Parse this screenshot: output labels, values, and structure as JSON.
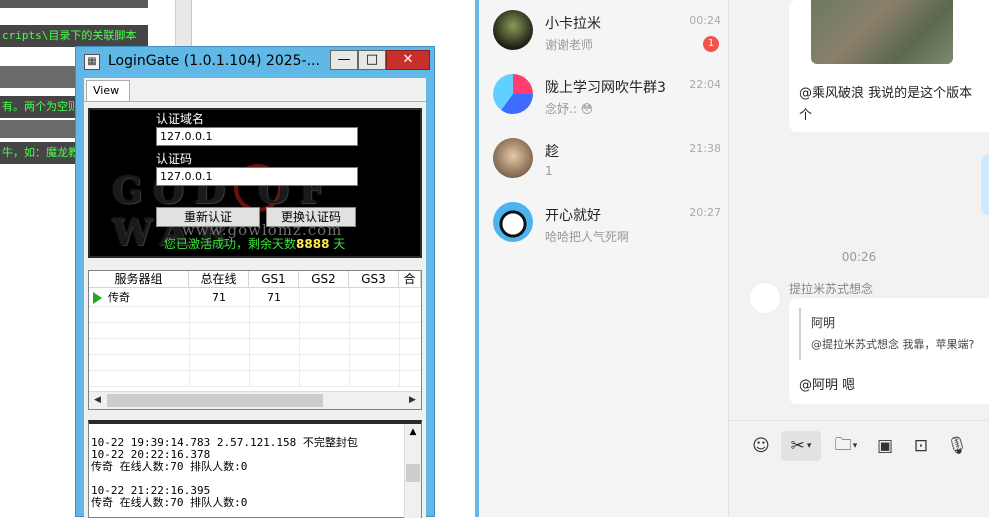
{
  "editor_bg": {
    "lines": [
      {
        "text": "cripts\\目录下的关联脚本"
      },
      {
        "text": "有。两个为空则"
      },
      {
        "text": "牛，如：魔龙教"
      }
    ]
  },
  "login_gate": {
    "title": "LoginGate (1.0.1.104)  2025-...",
    "minimize": "—",
    "maximize": "□",
    "close": "✕",
    "tab_view": "View",
    "auth_domain_label": "认证域名",
    "auth_domain_value": "127.0.0.1",
    "auth_code_label": "认证码",
    "auth_code_value": "127.0.0.1",
    "btn_reauth": "重新认证",
    "btn_change_code": "更换认证码",
    "status_prefix": "您已激活成功，剩余天数",
    "status_days": "8888",
    "status_suffix": "天",
    "banner_url": "www.gowlomz.com",
    "banner_logo": "GOD OF WAR",
    "columns": [
      "服务器组",
      "总在线",
      "GS1",
      "GS2",
      "GS3",
      "合计"
    ],
    "rows": [
      {
        "name": "传奇",
        "total": "71",
        "gs1": "71"
      }
    ],
    "log": [
      "10-22 19:39:14.783 2.57.121.158 不完整封包",
      "10-22 20:22:16.378",
      "传奇 在线人数:70 排队人数:0",
      "",
      "10-22 21:22:16.395",
      "传奇 在线人数:70 排队人数:0"
    ]
  },
  "chat_list": [
    {
      "name": "小卡拉米",
      "time": "00:24",
      "preview": "谢谢老师",
      "unread": "1",
      "color": "#2a3020"
    },
    {
      "name": "陇上学习网吹牛群3",
      "time": "22:04",
      "preview": "念妤.: 😳",
      "unread": "",
      "color": "#3d6bff"
    },
    {
      "name": "趁",
      "time": "21:38",
      "preview": "1",
      "unread": "",
      "color": "#b9a083"
    },
    {
      "name": "开心就好",
      "time": "20:27",
      "preview": "哈哈把人气死啊",
      "unread": "",
      "color": "#4db3ef"
    }
  ],
  "chat_main": {
    "msg1": "@乘风破浪  我说的是这个版本",
    "msg1_cont": "个",
    "time_divider": "00:26",
    "sender": "提拉米苏式想念",
    "quote_name": "阿明",
    "quote_text": "@提拉米苏式想念 我靠，苹果端?",
    "reply": "@阿明 嗯"
  }
}
